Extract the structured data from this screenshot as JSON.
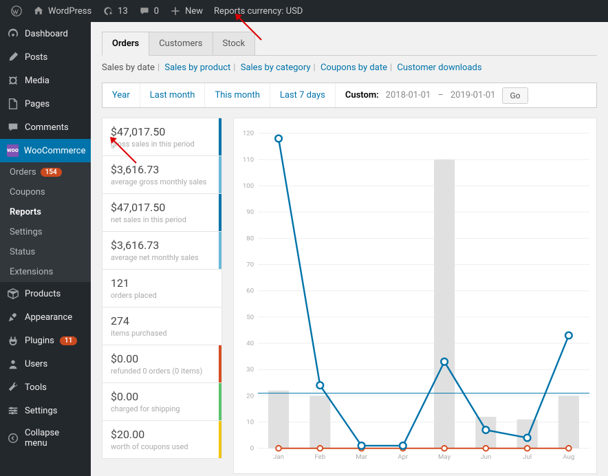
{
  "topbar": {
    "site": "WordPress",
    "updates": "13",
    "comments": "0",
    "new": "New",
    "currency": "Reports currency: USD"
  },
  "sidebar": {
    "dashboard": "Dashboard",
    "posts": "Posts",
    "media": "Media",
    "pages": "Pages",
    "comments": "Comments",
    "woocommerce": "WooCommerce",
    "submenu": {
      "orders": "Orders",
      "orders_badge": "154",
      "coupons": "Coupons",
      "reports": "Reports",
      "settings": "Settings",
      "status": "Status",
      "extensions": "Extensions"
    },
    "products": "Products",
    "appearance": "Appearance",
    "plugins": "Plugins",
    "plugins_badge": "11",
    "users": "Users",
    "tools": "Tools",
    "settings2": "Settings",
    "collapse": "Collapse menu"
  },
  "tabs": {
    "orders": "Orders",
    "customers": "Customers",
    "stock": "Stock"
  },
  "filters": {
    "sales_by_date": "Sales by date",
    "sales_by_product": "Sales by product",
    "sales_by_category": "Sales by category",
    "coupons_by_date": "Coupons by date",
    "customer_downloads": "Customer downloads"
  },
  "date_nav": {
    "year": "Year",
    "last_month": "Last month",
    "this_month": "This month",
    "last_7_days": "Last 7 days",
    "custom": "Custom:",
    "from": "2018-01-01",
    "to": "2019-01-01",
    "go": "Go"
  },
  "stats": [
    {
      "value": "$47,017.50",
      "label": "gross sales in this period",
      "border": "#0073aa"
    },
    {
      "value": "$3,616.73",
      "label": "average gross monthly sales",
      "border": "#6bb9d8"
    },
    {
      "value": "$47,017.50",
      "label": "net sales in this period",
      "border": "#0073aa"
    },
    {
      "value": "$3,616.73",
      "label": "average net monthly sales",
      "border": "#6bb9d8"
    },
    {
      "value": "121",
      "label": "orders placed",
      "border": ""
    },
    {
      "value": "274",
      "label": "items purchased",
      "border": ""
    },
    {
      "value": "$0.00",
      "label": "refunded 0 orders (0 items)",
      "border": "#d54e21"
    },
    {
      "value": "$0.00",
      "label": "charged for shipping",
      "border": "#5bc26d"
    },
    {
      "value": "$20.00",
      "label": "worth of coupons used",
      "border": "#f1c40f"
    }
  ],
  "chart_data": {
    "type": "line",
    "title": "",
    "ylabel": "",
    "xlabel": "",
    "ylim": [
      0,
      120
    ],
    "categories": [
      "Jan",
      "Feb",
      "Mar",
      "Apr",
      "May",
      "Jun",
      "Jul",
      "Aug"
    ],
    "bars": [
      22,
      20,
      0,
      0,
      110,
      12,
      11,
      20
    ],
    "line_blue": [
      118,
      24,
      1,
      1,
      33,
      7,
      4,
      43
    ],
    "line_red": [
      0,
      0,
      0,
      0,
      0,
      0,
      0,
      0
    ],
    "avg_line": 21
  }
}
